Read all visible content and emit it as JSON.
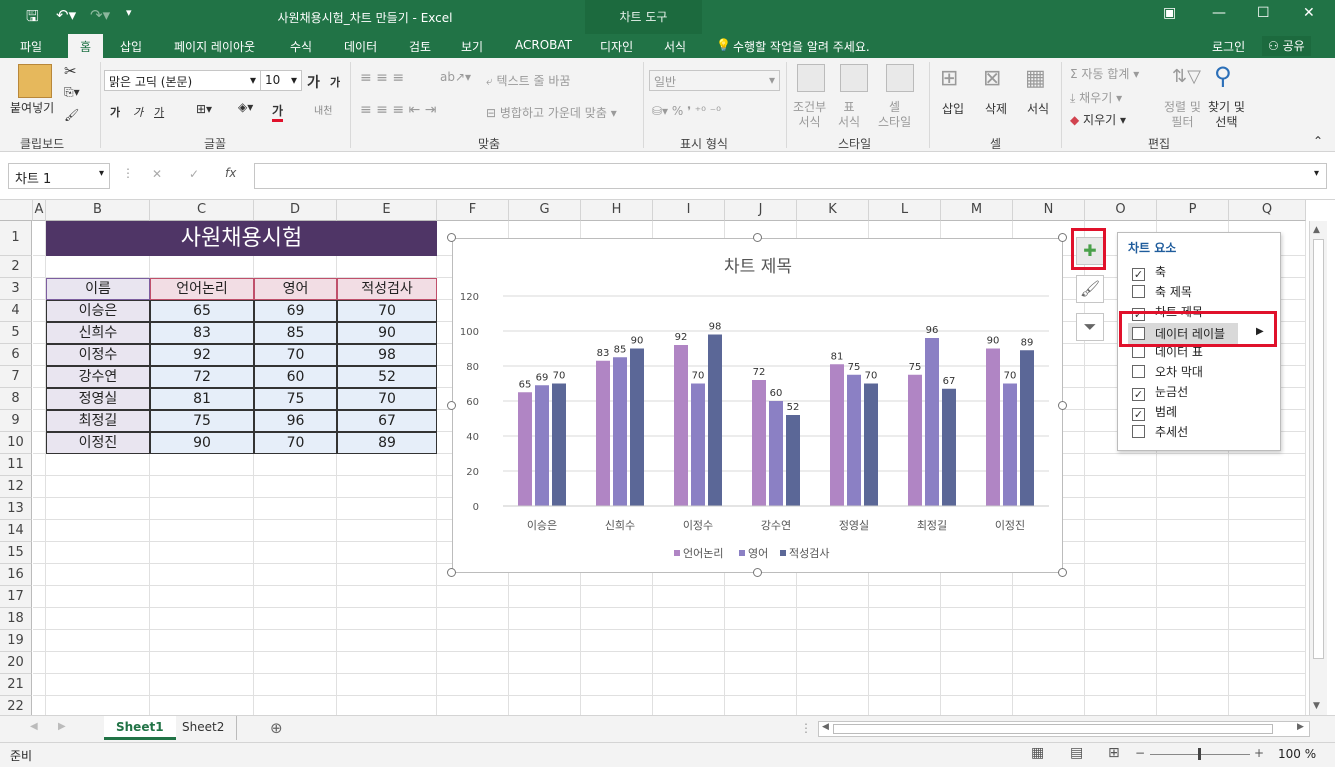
{
  "window": {
    "title": "사원채용시험_차트 만들기 - Excel",
    "context_tab": "차트 도구",
    "colors": {
      "brand": "#217346",
      "accent_red": "#e0112b",
      "header_fill": "#4f3566",
      "series1": "#b085c4",
      "series2": "#8b80c4",
      "series3": "#5b6797"
    }
  },
  "tabs": [
    "파일",
    "홈",
    "삽입",
    "페이지 레이아웃",
    "수식",
    "데이터",
    "검토",
    "보기",
    "ACROBAT",
    "디자인",
    "서식"
  ],
  "tellme": "수행할 작업을 알려 주세요.",
  "account": {
    "login": "로그인",
    "share": "공유"
  },
  "ribbon": {
    "clipboard": {
      "paste": "붙여넣기",
      "label": "클립보드"
    },
    "font": {
      "name": "맑은 고딕 (본문)",
      "size": "10",
      "label": "글꼴",
      "big_a": "가",
      "small_a": "가",
      "bold": "가",
      "italic": "가",
      "underline": "가",
      "red_a": "가",
      "phonetic": "내천"
    },
    "align": {
      "wrap": "텍스트 줄 바꿈",
      "merge": "병합하고 가운데 맞춤",
      "label": "맞춤"
    },
    "number": {
      "format": "일반",
      "label": "표시 형식"
    },
    "styles": {
      "cond": "조건부\n서식",
      "table": "표\n서식",
      "cell": "셀\n스타일",
      "label": "스타일"
    },
    "cells": {
      "insert": "삽입",
      "delete": "삭제",
      "format": "서식",
      "label": "셀"
    },
    "editing": {
      "autosum": "자동 합계",
      "fill": "채우기",
      "clear": "지우기",
      "sort": "정렬 및\n필터",
      "find": "찾기 및\n선택",
      "label": "편집"
    }
  },
  "formula_bar": {
    "name_box": "차트 1",
    "fx": "fx",
    "value": ""
  },
  "columns": [
    "A",
    "B",
    "C",
    "D",
    "E",
    "F",
    "G",
    "H",
    "I",
    "J",
    "K",
    "L",
    "M",
    "N",
    "O",
    "P",
    "Q"
  ],
  "rows": [
    "1",
    "2",
    "3",
    "4",
    "5",
    "6",
    "7",
    "8",
    "9",
    "10",
    "11",
    "12",
    "13",
    "14",
    "15",
    "16",
    "17",
    "18",
    "19",
    "20",
    "21",
    "22"
  ],
  "table": {
    "title": "사원채용시험",
    "headers": [
      "이름",
      "언어논리",
      "영어",
      "적성검사"
    ],
    "rows": [
      [
        "이승은",
        "65",
        "69",
        "70"
      ],
      [
        "신희수",
        "83",
        "85",
        "90"
      ],
      [
        "이정수",
        "92",
        "70",
        "98"
      ],
      [
        "강수연",
        "72",
        "60",
        "52"
      ],
      [
        "정영실",
        "81",
        "75",
        "70"
      ],
      [
        "최정길",
        "75",
        "96",
        "67"
      ],
      [
        "이정진",
        "90",
        "70",
        "89"
      ]
    ]
  },
  "chart_data": {
    "type": "bar",
    "title": "차트 제목",
    "categories": [
      "이승은",
      "신희수",
      "이정수",
      "강수연",
      "정영실",
      "최정길",
      "이정진"
    ],
    "series": [
      {
        "name": "언어논리",
        "values": [
          65,
          83,
          92,
          72,
          81,
          75,
          90
        ],
        "color": "#b085c4"
      },
      {
        "name": "영어",
        "values": [
          69,
          85,
          70,
          60,
          75,
          96,
          70
        ],
        "color": "#8b80c4"
      },
      {
        "name": "적성검사",
        "values": [
          70,
          90,
          98,
          52,
          70,
          67,
          89
        ],
        "color": "#5b6797"
      }
    ],
    "ylim": [
      0,
      120
    ],
    "yticks": [
      0,
      20,
      40,
      60,
      80,
      100,
      120
    ],
    "grid": true,
    "legend": "bottom",
    "data_labels": true
  },
  "chart_elements_popup": {
    "title": "차트 요소",
    "items": [
      {
        "label": "축",
        "checked": true
      },
      {
        "label": "축 제목",
        "checked": false
      },
      {
        "label": "차트 제목",
        "checked": true
      },
      {
        "label": "데이터 레이블",
        "checked": false,
        "highlighted": true
      },
      {
        "label": "데이터 표",
        "checked": false
      },
      {
        "label": "오차 막대",
        "checked": false
      },
      {
        "label": "눈금선",
        "checked": true
      },
      {
        "label": "범례",
        "checked": true
      },
      {
        "label": "추세선",
        "checked": false
      }
    ]
  },
  "sheets": [
    {
      "name": "Sheet1",
      "active": true
    },
    {
      "name": "Sheet2",
      "active": false
    }
  ],
  "status": {
    "ready": "준비",
    "zoom": "100 %"
  }
}
